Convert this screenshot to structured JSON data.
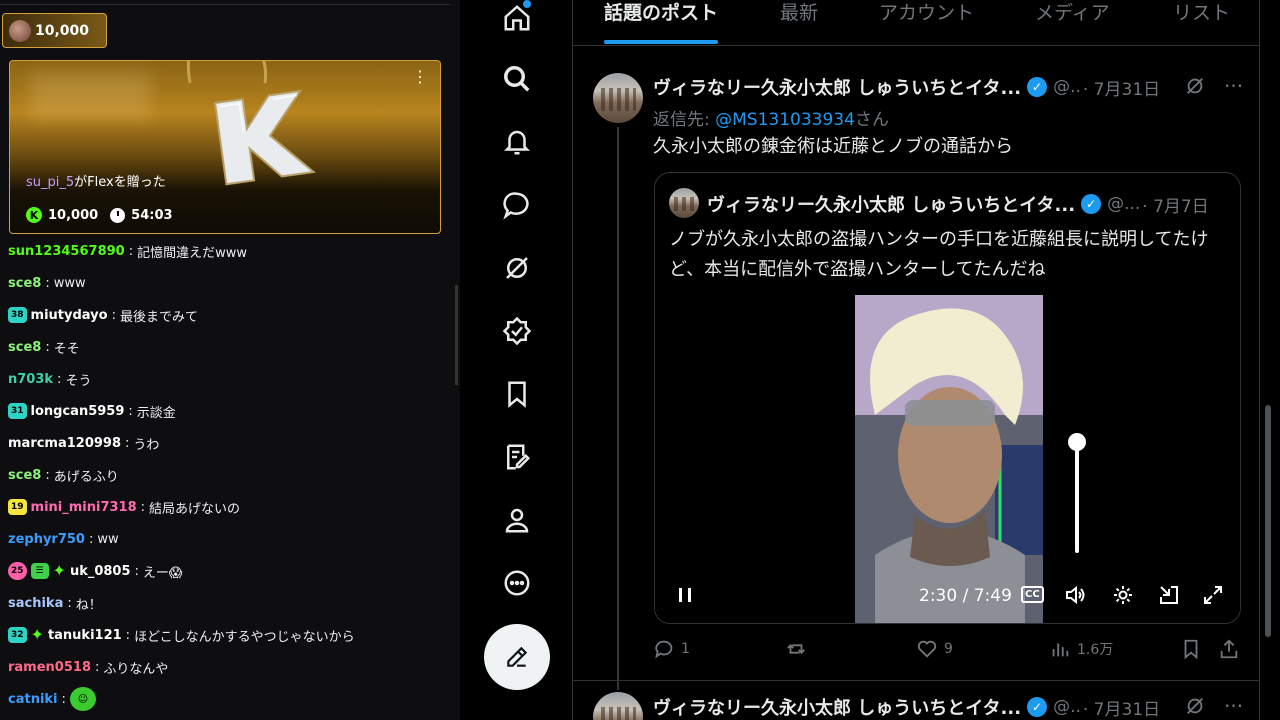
{
  "chat": {
    "coin_amount": "10,000",
    "flex_card": {
      "gift_user": "su_pi_5",
      "gift_text": "がFlexを贈った",
      "amount": "10,000",
      "timer": "54:03",
      "menu_icon": "more-vert-icon",
      "k_badge": "K"
    },
    "messages": [
      {
        "user": "sun1234567890",
        "color": "#53fc18",
        "text": "記憶間違えだwww",
        "badges": []
      },
      {
        "user": "sce8",
        "color": "#8cf27c",
        "text": "www",
        "badges": []
      },
      {
        "user": "miutydayo",
        "color": "#ffffff",
        "text": "最後までみて",
        "badges": [
          {
            "type": "teal",
            "label": "38"
          }
        ]
      },
      {
        "user": "sce8",
        "color": "#8cf27c",
        "text": "そそ",
        "badges": []
      },
      {
        "user": "n703k",
        "color": "#3fd1a2",
        "text": "そう",
        "badges": []
      },
      {
        "user": "longcan5959",
        "color": "#ffffff",
        "text": "示談金",
        "badges": [
          {
            "type": "teal",
            "label": "31"
          }
        ]
      },
      {
        "user": "marcma120998",
        "color": "#ffffff",
        "text": "うわ",
        "badges": []
      },
      {
        "user": "sce8",
        "color": "#8cf27c",
        "text": "あげるふり",
        "badges": []
      },
      {
        "user": "mini_mini7318",
        "color": "#ff6ab0",
        "text": "結局あげないの",
        "badges": [
          {
            "type": "yellow",
            "label": "19"
          }
        ]
      },
      {
        "user": "zephyr750",
        "color": "#3b9cff",
        "text": "ww",
        "badges": []
      },
      {
        "user": "uk_0805",
        "color": "#ffffff",
        "text": "えー😱",
        "badges": [
          {
            "type": "pink",
            "label": "25"
          },
          {
            "type": "green",
            "label": "☰"
          },
          {
            "type": "spark",
            "label": "✦"
          }
        ]
      },
      {
        "user": "sachika",
        "color": "#a9c6ff",
        "text": "ね！",
        "badges": []
      },
      {
        "user": "tanuki121",
        "color": "#ffffff",
        "text": "ほどこしなんかするやつじゃないから",
        "badges": [
          {
            "type": "teal",
            "label": "32"
          },
          {
            "type": "spark",
            "label": "✦"
          }
        ]
      },
      {
        "user": "ramen0518",
        "color": "#ff6a8a",
        "text": "ふりなんや",
        "badges": []
      },
      {
        "user": "catniki",
        "color": "#3b9cff",
        "text": "",
        "badges": [],
        "emote": "KEKW"
      }
    ]
  },
  "nav": {
    "items": [
      "home-icon",
      "search-icon",
      "bell-icon",
      "chat-bubble-icon",
      "grok-icon",
      "verified-check-icon",
      "bookmark-icon",
      "lists-icon",
      "profile-icon",
      "more-circle-icon"
    ],
    "compose_icon": "compose-icon"
  },
  "tabs": [
    "話題のポスト",
    "最新",
    "アカウント",
    "メディア",
    "リスト"
  ],
  "post1": {
    "name": "ヴィラなリー久永小太郎 しゅういちとイタ...",
    "handle": "@..",
    "date": "· 7月31日",
    "reply_label": "返信先: ",
    "reply_handle": "@MS131033934",
    "reply_suffix": "さん",
    "text": "久永小太郎の錬金術は近藤とノブの通話から",
    "quote": {
      "name": "ヴィラなリー久永小太郎 しゅういちとイタ...",
      "handle": "@...",
      "date": "· 7月7日",
      "text": "ノブが久永小太郎の盗撮ハンターの手口を近藤組長に説明してたけど、本当に配信外で盗撮ハンターしてたんだね",
      "video": {
        "time": "2:30 / 7:49",
        "volume": 0.9,
        "cc": "CC"
      }
    },
    "actions": {
      "replies": "1",
      "reposts": "",
      "likes": "9",
      "views": "1.6万"
    }
  },
  "post2": {
    "name": "ヴィラなリー久永小太郎 しゅういちとイタ...",
    "handle": "@..",
    "date": "· 7月31日"
  }
}
